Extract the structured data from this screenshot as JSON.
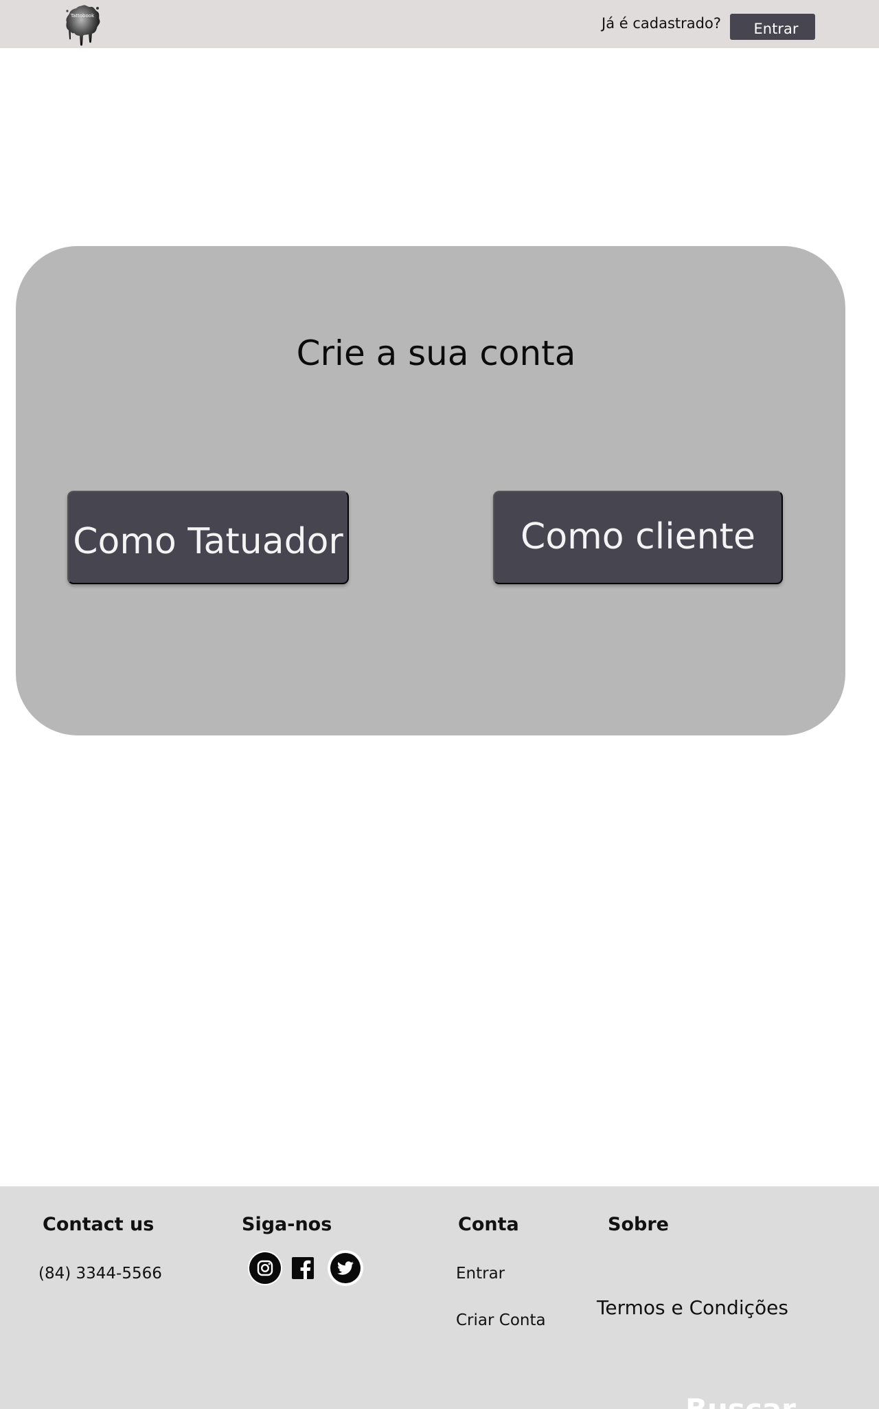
{
  "header": {
    "logo_text": "Tattobook",
    "already_registered": "Já é cadastrado?",
    "login_button": "Entrar"
  },
  "card": {
    "title": "Crie a sua conta",
    "tattoo_artist_button": "Como Tatuador",
    "client_button": "Como cliente"
  },
  "footer": {
    "contact": {
      "heading": "Contact us",
      "phone": "(84) 3344-5566"
    },
    "follow": {
      "heading": "Siga-nos",
      "icons": [
        "instagram-icon",
        "facebook-icon",
        "twitter-icon"
      ]
    },
    "account": {
      "heading": "Conta",
      "links": [
        "Entrar",
        "Criar Conta"
      ]
    },
    "about": {
      "heading": "Sobre",
      "terms": "Termos e Condições"
    },
    "search_label": "Buscar"
  },
  "colors": {
    "header_bg": "#e1dcdc",
    "button_bg": "#464550",
    "card_bg": "#b7b7b7",
    "footer_bg": "#dcdcdc"
  }
}
